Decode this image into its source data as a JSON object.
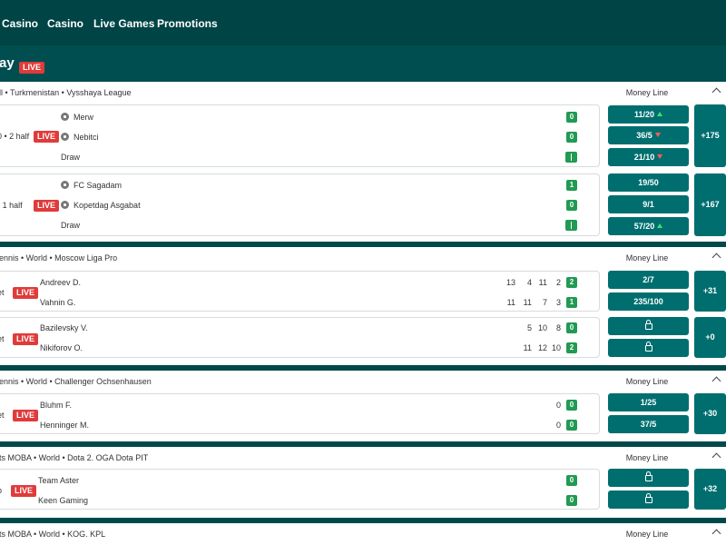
{
  "nav": {
    "items": [
      "Casino",
      "Casino",
      "Live Games",
      "Promotions"
    ]
  },
  "page": {
    "title": "ay",
    "live": "LIVE"
  },
  "sections": [
    {
      "crumb": "ll  •  Turkmenistan  •  Vysshaya League",
      "market": "Money Line",
      "events": [
        {
          "status": "0 • 2 half",
          "live": "LIVE",
          "teams": [
            "Merw",
            "Nebitci",
            "Draw"
          ],
          "scores": [
            "0",
            "0"
          ],
          "odds": [
            "11/20",
            "36/5",
            "21/10"
          ],
          "more": "+175"
        },
        {
          "status": "• 1 half",
          "live": "LIVE",
          "teams": [
            "FC Sagadam",
            "Kopetdag Asgabat",
            "Draw"
          ],
          "scores": [
            "1",
            "0"
          ],
          "odds": [
            "19/50",
            "9/1",
            "57/20"
          ],
          "more": "+167"
        }
      ]
    },
    {
      "crumb": "ennis  •  World  •  Moscow Liga Pro",
      "market": "Money Line",
      "events": [
        {
          "status": "et",
          "live": "LIVE",
          "teams": [
            "Andreev D.",
            "Vahnin G."
          ],
          "sets": [
            [
              "13",
              "4",
              "11",
              "2"
            ],
            [
              "11",
              "11",
              "7",
              "3"
            ]
          ],
          "scores": [
            "2",
            "1"
          ],
          "odds": [
            "2/7",
            "235/100"
          ],
          "more": "+31"
        },
        {
          "status": "et",
          "live": "LIVE",
          "teams": [
            "Bazilevsky V.",
            "Nikiforov O."
          ],
          "sets": [
            [
              "5",
              "10",
              "8"
            ],
            [
              "11",
              "12",
              "10"
            ]
          ],
          "scores": [
            "0",
            "2"
          ],
          "more": "+0"
        }
      ]
    },
    {
      "crumb": "ennis  •  World  •  Challenger Ochsenhausen",
      "market": "Money Line",
      "events": [
        {
          "status": "et",
          "live": "LIVE",
          "teams": [
            "Bluhm F.",
            "Henninger M."
          ],
          "sets": [
            [
              "0"
            ],
            [
              "0"
            ]
          ],
          "scores": [
            "0",
            "0"
          ],
          "odds": [
            "1/25",
            "37/5"
          ],
          "more": "+30"
        }
      ]
    },
    {
      "crumb": "ts MOBA  •  World  •  Dota 2. OGA Dota PIT",
      "market": "Money Line",
      "events": [
        {
          "status": "p",
          "live": "LIVE",
          "teams": [
            "Team Aster",
            "Keen Gaming"
          ],
          "scores": [
            "0",
            "0"
          ],
          "more": "+32"
        }
      ]
    },
    {
      "crumb": "ts MOBA  •  World  •  KOG. KPL",
      "market": "Money Line"
    }
  ],
  "colors": {
    "live": "#e03b3b",
    "score": "#219a53",
    "odd": "#006e6f",
    "up": "#3ee07a",
    "down": "#ff5d5d"
  }
}
